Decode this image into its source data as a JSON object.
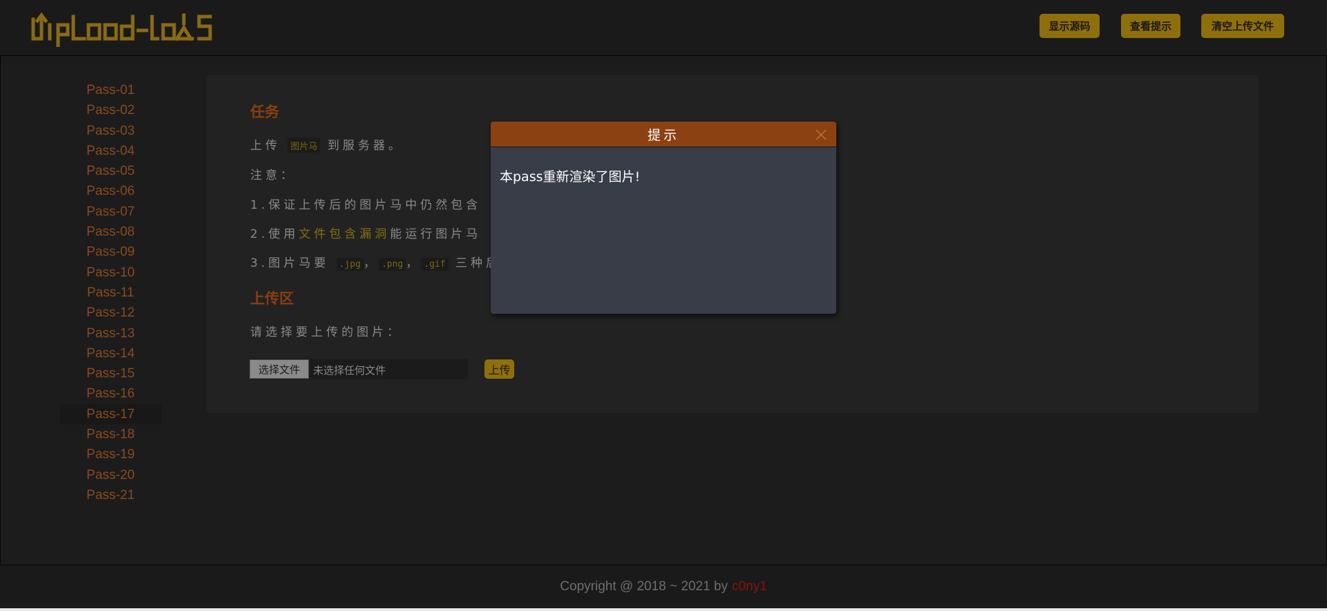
{
  "header": {
    "logo_text": "Upload-labs",
    "buttons": [
      "显示源码",
      "查看提示",
      "清空上传文件"
    ],
    "accent_color": "#8f6e0c"
  },
  "sidebar": {
    "items": [
      "Pass-01",
      "Pass-02",
      "Pass-03",
      "Pass-04",
      "Pass-05",
      "Pass-06",
      "Pass-07",
      "Pass-08",
      "Pass-09",
      "Pass-10",
      "Pass-11",
      "Pass-12",
      "Pass-13",
      "Pass-14",
      "Pass-15",
      "Pass-16",
      "Pass-17",
      "Pass-18",
      "Pass-19",
      "Pass-20",
      "Pass-21"
    ],
    "active": "Pass-17"
  },
  "task": {
    "title": "任务",
    "line1_pre": "上传",
    "line1_code": "图片马",
    "line1_post": "到服务器。",
    "note_label": "注意：",
    "note1": "1.保证上传后的图片马中仍然包含",
    "note2_pre": "2.使用",
    "note2_hl": "文件包含漏洞",
    "note2_post": "能运行图片马",
    "note3_pre": "3.图片马要",
    "note3_code1": ".jpg",
    "note3_sep1": "，",
    "note3_code2": ".png",
    "note3_sep2": "，",
    "note3_code3": ".gif",
    "note3_post": "三种后"
  },
  "upload": {
    "title": "上传区",
    "prompt": "请选择要上传的图片：",
    "choose_label": "选择文件",
    "no_file_text": "未选择任何文件",
    "submit_label": "上传"
  },
  "modal": {
    "title": "提示",
    "message": "本pass重新渲染了图片!"
  },
  "footer": {
    "copyright": "Copyright @ 2018 ~ 2021 by",
    "author": "c0ny1"
  }
}
